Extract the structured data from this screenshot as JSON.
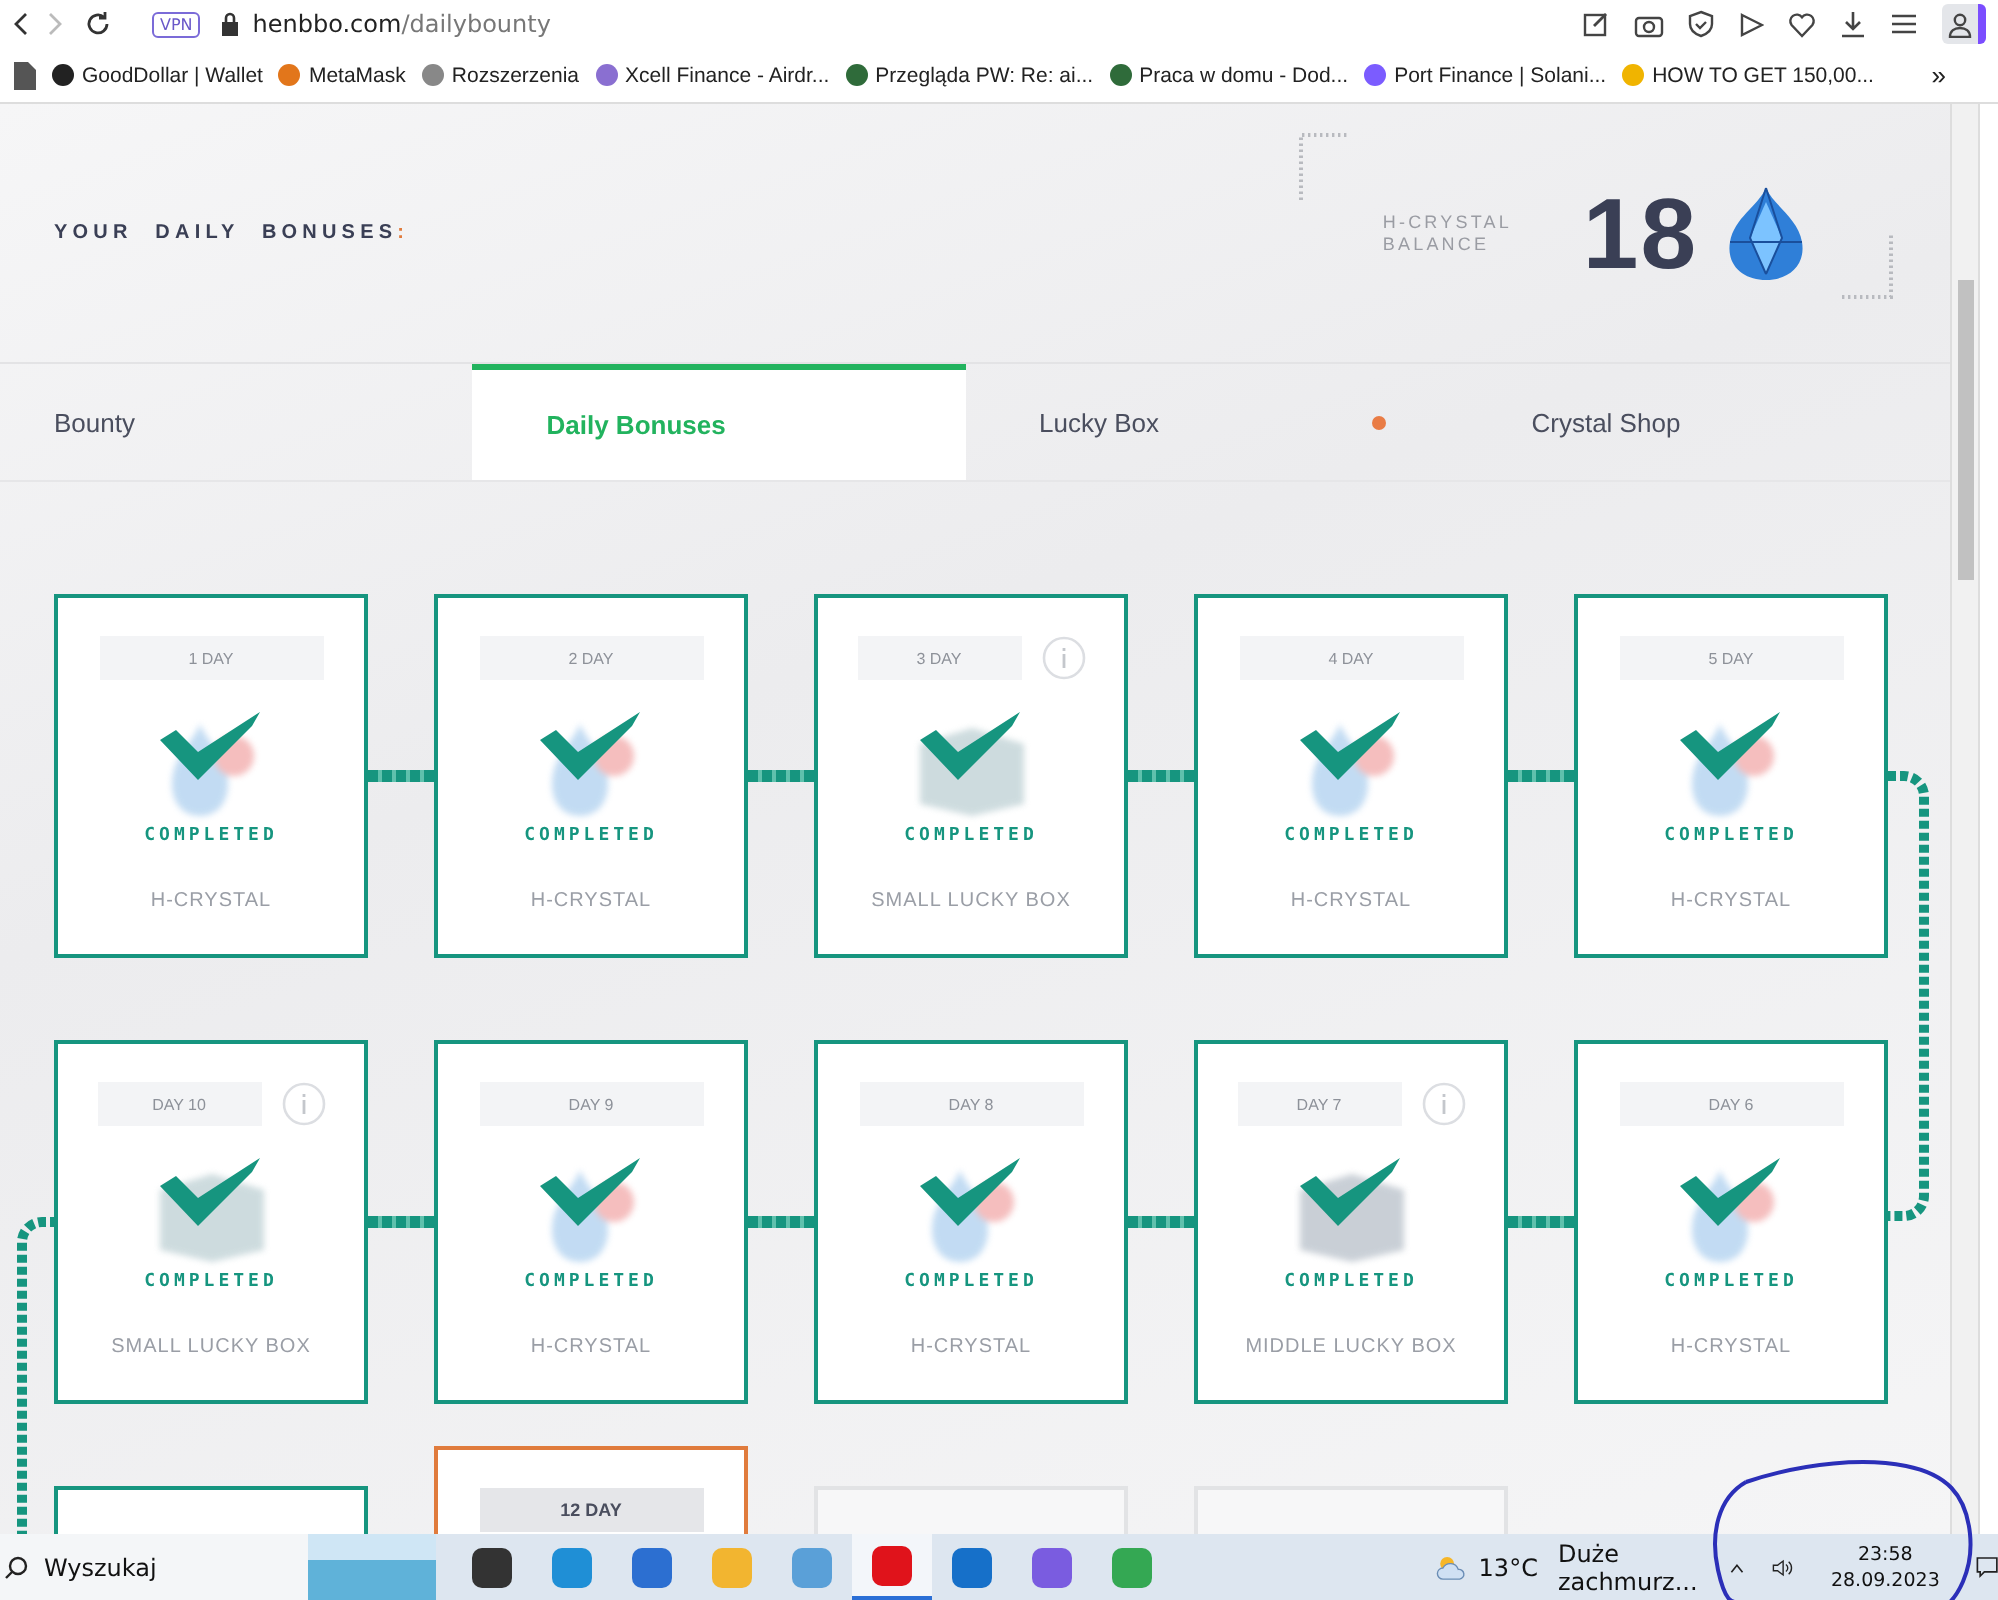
{
  "browser": {
    "vpn": "VPN",
    "url_host": "henbbo.com",
    "url_path": "/dailybounty",
    "more": "»",
    "bookmarks": [
      {
        "label": "GoodDollar | Wallet",
        "kind": "g"
      },
      {
        "label": "MetaMask",
        "kind": "fox"
      },
      {
        "label": "Rozszerzenia",
        "kind": "cube"
      },
      {
        "label": "Xcell Finance - Airdr...",
        "kind": "hex"
      },
      {
        "label": "Przegląda PW: Re: ai...",
        "kind": "avatar"
      },
      {
        "label": "Praca w domu - Dod...",
        "kind": "avatar"
      },
      {
        "label": "Port Finance | Solani...",
        "kind": "s"
      },
      {
        "label": "HOW TO GET 150,00...",
        "kind": "coin"
      }
    ]
  },
  "header": {
    "title": "YOUR DAILY BONUSES",
    "title_mark": ":",
    "balance_label": "H-CRYSTAL BALANCE",
    "balance": "18"
  },
  "tabs": [
    {
      "label": "Bounty",
      "selected": false,
      "dot": false
    },
    {
      "label": "Daily Bonuses",
      "selected": true,
      "dot": false
    },
    {
      "label": "Lucky Box",
      "selected": false,
      "dot": true
    },
    {
      "label": "Crystal Shop",
      "selected": false,
      "dot": false
    }
  ],
  "rows": [
    {
      "connected": true,
      "cards": [
        {
          "day": "1 DAY",
          "reward": "H-CRYSTAL",
          "kind": "crystal",
          "completed": true,
          "current": false,
          "status_text": "COMPLETED",
          "info": false
        },
        {
          "day": "2 DAY",
          "reward": "H-CRYSTAL",
          "kind": "crystal",
          "completed": true,
          "current": false,
          "status_text": "COMPLETED",
          "info": false
        },
        {
          "day": "3 DAY",
          "reward": "SMALL LUCKY BOX",
          "kind": "box",
          "completed": true,
          "current": false,
          "status_text": "COMPLETED",
          "info": true
        },
        {
          "day": "4 DAY",
          "reward": "H-CRYSTAL",
          "kind": "crystal",
          "completed": true,
          "current": false,
          "status_text": "COMPLETED",
          "info": false
        },
        {
          "day": "5 DAY",
          "reward": "H-CRYSTAL",
          "kind": "crystal",
          "completed": true,
          "current": false,
          "status_text": "COMPLETED",
          "info": false
        }
      ]
    },
    {
      "connected": true,
      "cards": [
        {
          "day": "DAY 10",
          "reward": "SMALL LUCKY BOX",
          "kind": "box",
          "completed": true,
          "current": false,
          "status_text": "COMPLETED",
          "info": true
        },
        {
          "day": "DAY 9",
          "reward": "H-CRYSTAL",
          "kind": "crystal",
          "completed": true,
          "current": false,
          "status_text": "COMPLETED",
          "info": false
        },
        {
          "day": "DAY 8",
          "reward": "H-CRYSTAL",
          "kind": "crystal",
          "completed": true,
          "current": false,
          "status_text": "COMPLETED",
          "info": false
        },
        {
          "day": "DAY 7",
          "reward": "MIDDLE LUCKY BOX",
          "kind": "box",
          "completed": true,
          "current": false,
          "status_text": "COMPLETED",
          "info": true
        },
        {
          "day": "DAY 6",
          "reward": "H-CRYSTAL",
          "kind": "crystal",
          "completed": true,
          "current": false,
          "status_text": "COMPLETED",
          "info": false
        }
      ]
    },
    {
      "cards": [
        {
          "completed": true,
          "current": false
        },
        {
          "day": "12 DAY",
          "completed": false,
          "current": true
        },
        {
          "completed": false,
          "current": false
        },
        {
          "completed": false,
          "current": false
        }
      ]
    }
  ],
  "taskbar": {
    "search_placeholder": "Wyszukaj",
    "apps": [
      {
        "kind": "taskview",
        "selected": false
      },
      {
        "kind": "edge",
        "selected": false
      },
      {
        "kind": "store",
        "selected": false
      },
      {
        "kind": "folder",
        "selected": false
      },
      {
        "kind": "laptop",
        "selected": false
      },
      {
        "kind": "opera",
        "selected": true
      },
      {
        "kind": "mail",
        "selected": false
      },
      {
        "kind": "copilot",
        "selected": false
      },
      {
        "kind": "chrome",
        "selected": false
      }
    ],
    "temperature": "13°C",
    "weather": "Duże zachmurz...",
    "time": "23:58",
    "date": "28.09.2023"
  }
}
